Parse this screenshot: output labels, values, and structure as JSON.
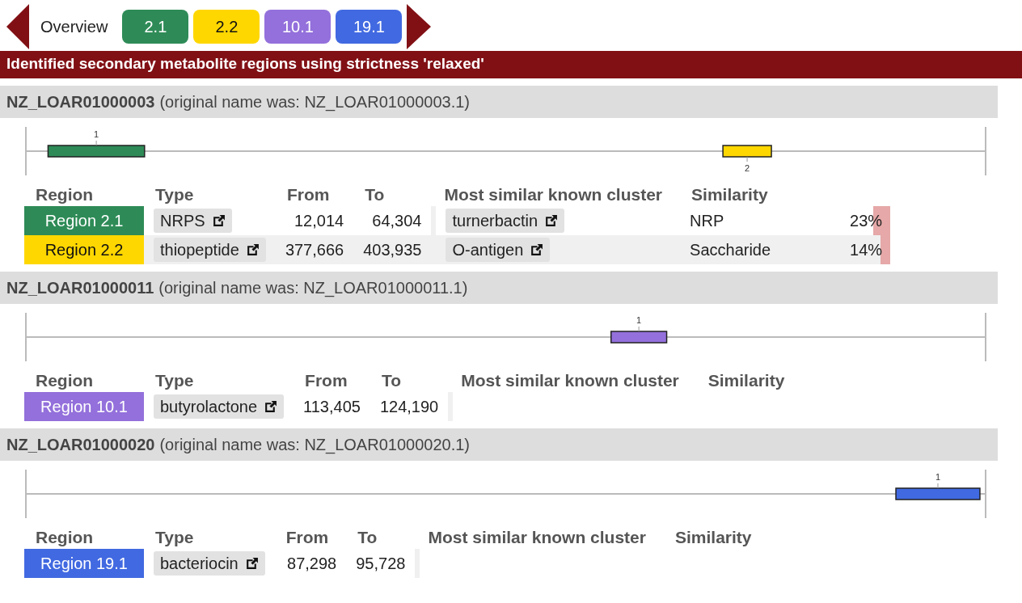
{
  "nav": {
    "overview": "Overview",
    "regions": [
      {
        "label": "2.1",
        "color": "#2e8b57"
      },
      {
        "label": "2.2",
        "color": "#ffd700"
      },
      {
        "label": "10.1",
        "color": "#9370db"
      },
      {
        "label": "19.1",
        "color": "#4169e1"
      }
    ]
  },
  "banner": "Identified secondary metabolite regions using strictness 'relaxed'",
  "records": [
    {
      "name": "NZ_LOAR01000003",
      "original": "(original name was: NZ_LOAR01000003.1)",
      "columns": [
        "Region",
        "Type",
        "From",
        "To",
        "Most similar known cluster",
        "Similarity"
      ],
      "regions": [
        {
          "marker": "1",
          "label": "Region 2.1",
          "color": "#2e8b57",
          "type": "NRPS",
          "from": "12,014",
          "to": "64,304",
          "cluster": "turnerbactin",
          "cluster_type": "NRP",
          "similarity": "23%",
          "level": 0.23
        },
        {
          "marker": "2",
          "label": "Region 2.2",
          "color": "#ffd700",
          "type": "thiopeptide",
          "from": "377,666",
          "to": "403,935",
          "cluster": "O-antigen",
          "cluster_type": "Saccharide",
          "similarity": "14%",
          "level": 0.14
        }
      ]
    },
    {
      "name": "NZ_LOAR01000011",
      "original": "(original name was: NZ_LOAR01000011.1)",
      "columns": [
        "Region",
        "Type",
        "From",
        "To",
        "Most similar known cluster",
        "Similarity"
      ],
      "regions": [
        {
          "marker": "1",
          "label": "Region 10.1",
          "color": "#9370db",
          "type": "butyrolactone",
          "from": "113,405",
          "to": "124,190"
        }
      ]
    },
    {
      "name": "NZ_LOAR01000020",
      "original": "(original name was: NZ_LOAR01000020.1)",
      "columns": [
        "Region",
        "Type",
        "From",
        "To",
        "Most similar known cluster",
        "Similarity"
      ],
      "regions": [
        {
          "marker": "1",
          "label": "Region 19.1",
          "color": "#4169e1",
          "type": "bacteriocin",
          "from": "87,298",
          "to": "95,728"
        }
      ]
    }
  ]
}
